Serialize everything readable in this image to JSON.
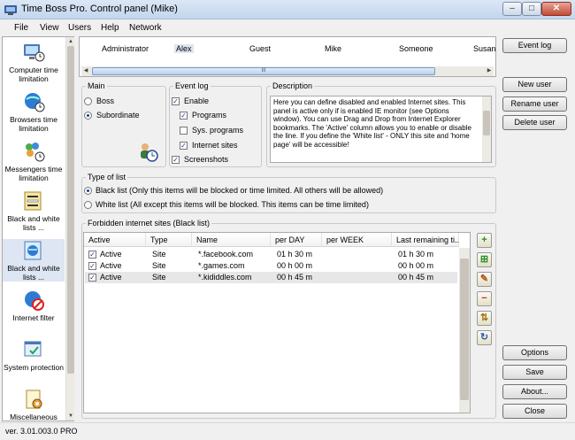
{
  "window": {
    "title": "Time Boss Pro. Control panel (Mike)",
    "min": "–",
    "max": "□",
    "close": "✕"
  },
  "menu": [
    "File",
    "View",
    "Users",
    "Help",
    "Network"
  ],
  "sidebar": [
    {
      "label": "Computer time limitation",
      "icon": "computer-time-icon"
    },
    {
      "label": "Browsers time limitation",
      "icon": "browser-time-icon"
    },
    {
      "label": "Messengers time limitation",
      "icon": "messenger-time-icon"
    },
    {
      "label": "Black and white lists ...",
      "icon": "lists-programs-icon"
    },
    {
      "label": "Black and white lists ...",
      "icon": "lists-internet-icon"
    },
    {
      "label": "Internet filter",
      "icon": "internet-filter-icon"
    },
    {
      "label": "System protection",
      "icon": "system-protection-icon"
    },
    {
      "label": "Miscellaneous",
      "icon": "miscellaneous-icon"
    }
  ],
  "users": [
    "Administrator",
    "Alex",
    "Guest",
    "Mike",
    "Someone",
    "Susan"
  ],
  "selected_user": "Alex",
  "scroll_grip": "III",
  "buttons_top": {
    "event_log": "Event log",
    "new_user": "New user",
    "rename_user": "Rename user",
    "delete_user": "Delete user"
  },
  "buttons_bottom": {
    "options": "Options",
    "save": "Save",
    "about": "About...",
    "close": "Close"
  },
  "main": {
    "title": "Main",
    "boss": "Boss",
    "subordinate": "Subordinate",
    "selected": "Subordinate"
  },
  "event_log": {
    "title": "Event log",
    "enable": "Enable",
    "enable_checked": true,
    "programs": "Programs",
    "programs_checked": true,
    "sys_programs": "Sys. programs",
    "sys_programs_checked": false,
    "internet_sites": "Internet sites",
    "internet_sites_checked": true,
    "screenshots": "Screenshots",
    "screenshots_checked": true
  },
  "description": {
    "title": "Description",
    "text": "Here you can define disabled and enabled Internet sites. This panel is active only if is enabled IE monitor (see Options window). You can use Drag and Drop from Internet Explorer bookmarks. The 'Active' column allows you to enable or disable the line. If you define the 'White list' - ONLY this site and 'home page' will be accessible!"
  },
  "type_of_list": {
    "title": "Type of list",
    "black": "Black list (Only this items will be blocked or time limited. All others will be allowed)",
    "white": "White list (All except this items will be blocked. This items can be time limited)",
    "selected": "black"
  },
  "table": {
    "title": "Forbidden internet sites (Black list)",
    "columns": [
      "Active",
      "Type",
      "Name",
      "per DAY",
      "per WEEK",
      "Last remaining ti..."
    ],
    "rows": [
      {
        "active": "Active",
        "type": "Site",
        "name": "*.facebook.com",
        "per_day": "01 h 30 m",
        "per_week": "",
        "last": "01 h 30 m"
      },
      {
        "active": "Active",
        "type": "Site",
        "name": "*.games.com",
        "per_day": "00 h 00 m",
        "per_week": "",
        "last": "00 h 00 m"
      },
      {
        "active": "Active",
        "type": "Site",
        "name": "*.kididdles.com",
        "per_day": "00 h 45 m",
        "per_week": "",
        "last": "00 h 45 m"
      }
    ]
  },
  "tools": [
    "add-icon",
    "add-group-icon",
    "edit-icon",
    "remove-icon",
    "move-icon",
    "refresh-icon"
  ],
  "status": "ver. 3.01.003.0 PRO"
}
